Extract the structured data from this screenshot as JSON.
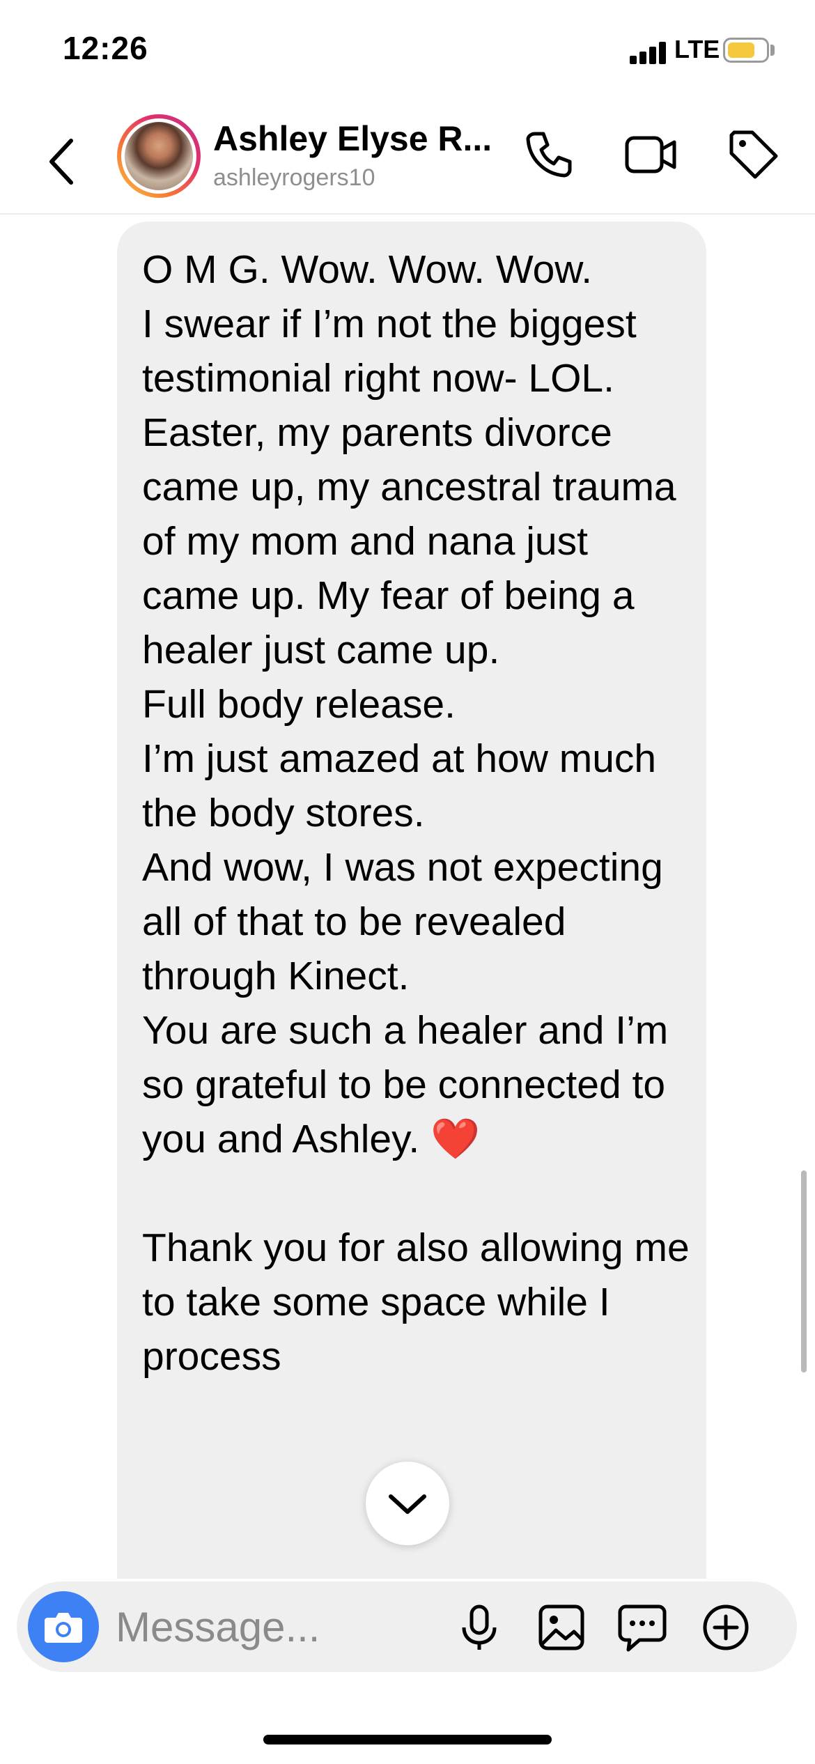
{
  "status_bar": {
    "time": "12:26",
    "network": "LTE",
    "battery_level": 0.62,
    "battery_color": "#f6c83e"
  },
  "header": {
    "contact_name": "Ashley Elyse R...",
    "username": "ashleyrogers10",
    "icons": [
      "chevron-left-icon",
      "phone-icon",
      "video-camera-icon",
      "tag-icon"
    ]
  },
  "message": {
    "text": "O M G. Wow. Wow. Wow.\nI swear if I’m not the biggest testimonial right now- LOL.\nEaster, my parents divorce came up, my ancestral trauma of my mom and nana just came up. My fear of being a healer just came up.\nFull body release.\nI’m just amazed at how much the body stores.\nAnd wow, I was not expecting all of that to be revealed through Kinect.\nYou are such a healer and I’m so grateful to be connected to you and Ashley. ",
    "emoji": "❤️",
    "text_continued": "\n\nThank you for also allowing me to take some space while I process"
  },
  "composer": {
    "placeholder": "Message...",
    "accent_color": "#3d81f4",
    "icons": [
      "camera-icon",
      "microphone-icon",
      "gallery-icon",
      "sticker-chat-icon",
      "plus-circle-icon"
    ]
  }
}
